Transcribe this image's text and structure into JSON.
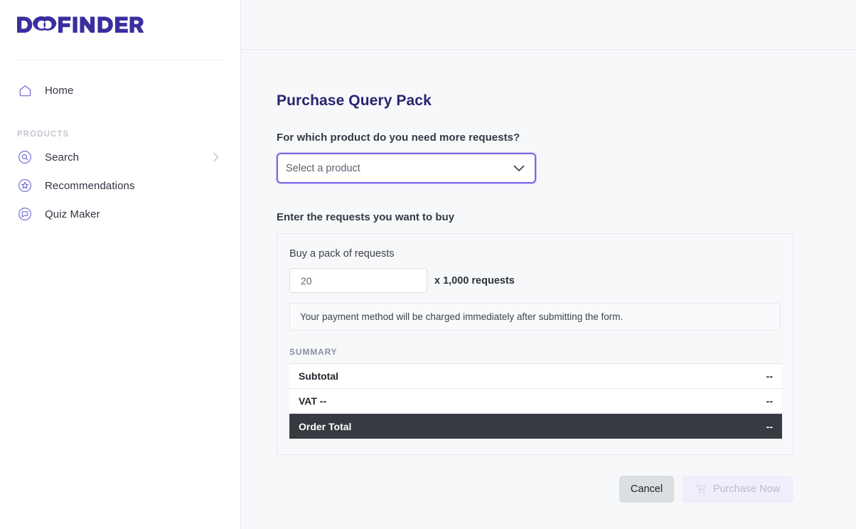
{
  "brand": {
    "logo_text": "DOOFINDER",
    "logo_color": "#3b2e9e"
  },
  "sidebar": {
    "home": {
      "label": "Home",
      "icon": "home-icon"
    },
    "section_label": "PRODUCTS",
    "items": [
      {
        "label": "Search",
        "icon": "search-circle-icon",
        "has_chevron": true
      },
      {
        "label": "Recommendations",
        "icon": "star-circle-icon",
        "has_chevron": false
      },
      {
        "label": "Quiz Maker",
        "icon": "chat-circle-icon",
        "has_chevron": false
      }
    ]
  },
  "main": {
    "page_title": "Purchase Query Pack",
    "product_question": "For which product do you need more requests?",
    "select": {
      "value": "Select a product",
      "icon": "chevron-down-icon"
    },
    "requests_heading": "Enter the requests you want to buy",
    "card": {
      "pack_label": "Buy a pack of requests",
      "quantity": "20",
      "multiplier_text": "x 1,000 requests",
      "notice": "Your payment method will be charged immediately after submitting the form.",
      "summary_label": "SUMMARY",
      "summary_rows": [
        {
          "label": "Subtotal",
          "value": "--",
          "emphasis": false
        },
        {
          "label": "VAT --",
          "value": "--",
          "emphasis": false
        },
        {
          "label": "Order Total",
          "value": "--",
          "emphasis": true
        }
      ]
    },
    "buttons": {
      "cancel": "Cancel",
      "purchase": "Purchase Now",
      "purchase_icon": "shopping-cart-icon",
      "purchase_disabled": true
    }
  },
  "colors": {
    "brand_purple": "#3b2e9e",
    "accent_focus": "#7b68e6",
    "page_bg": "#f7f8fa",
    "total_row_bg": "#373b41"
  }
}
